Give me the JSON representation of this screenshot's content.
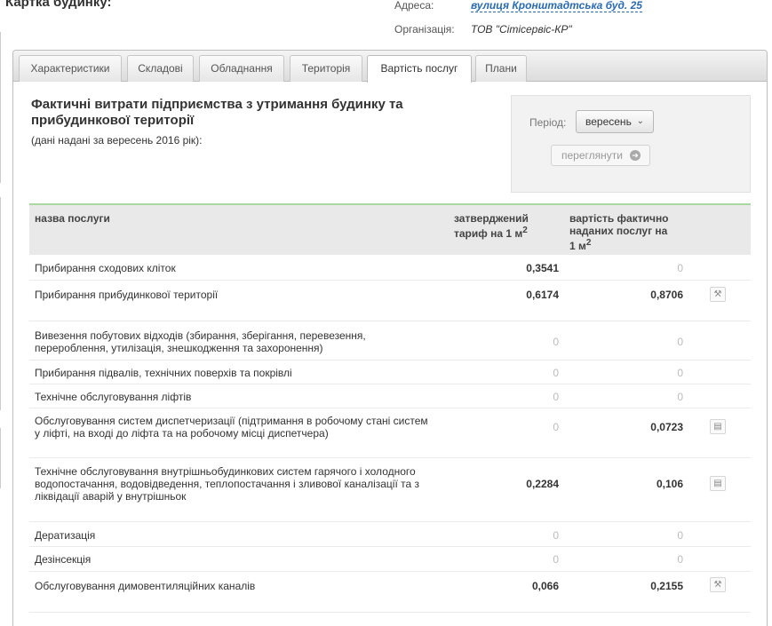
{
  "header": {
    "title": "Картка будинку:",
    "address_label": "Адреса:",
    "address_value": "вулиця Кронштадтська буд. 25",
    "org_label": "Організація:",
    "org_value": "ТОВ \"Сітісервіс-КР\""
  },
  "tabs": [
    {
      "label": "Характеристики",
      "active": false
    },
    {
      "label": "Складові",
      "active": false
    },
    {
      "label": "Обладнання",
      "active": false
    },
    {
      "label": "Територія",
      "active": false
    },
    {
      "label": "Вартість послуг",
      "active": true
    },
    {
      "label": "Плани",
      "active": false
    }
  ],
  "section": {
    "title": "Фактичні витрати підприємства з утримання будинку та прибудинкової території",
    "subtitle": "(дані надані за вересень 2016 рік):"
  },
  "period": {
    "label": "Період:",
    "selected": "вересень",
    "view_button": "переглянути"
  },
  "table": {
    "headers": {
      "name": "назва послуги",
      "tariff": "затверджений тариф на 1 м²",
      "cost": "вартість фактично наданих послуг на 1 м²"
    },
    "rows": [
      {
        "name": "Прибирання сходових кліток",
        "tariff": "0,3541",
        "cost": "0",
        "icon": ""
      },
      {
        "name": "Прибирання прибудинкової території",
        "tariff": "0,6174",
        "cost": "0,8706",
        "icon": "wrench-icon"
      },
      {
        "name": "Вивезення побутових відходів (збирання, зберігання, перевезення, перероблення, утилізація, знешкодження та захоронення)",
        "tariff": "0",
        "cost": "0",
        "icon": ""
      },
      {
        "name": "Прибирання підвалів, технічних поверхів та покрівлі",
        "tariff": "0",
        "cost": "0",
        "icon": ""
      },
      {
        "name": "Технічне обслуговування ліфтів",
        "tariff": "0",
        "cost": "0",
        "icon": ""
      },
      {
        "name": "Обслуговування систем диспетчеризації (підтримання в робочому стані систем у ліфті, на вході до ліфта та на робочому місці диспетчера)",
        "tariff": "0",
        "cost": "0,0723",
        "icon": "document-icon"
      },
      {
        "name": "Технічне обслуговування внутрішньобудинкових систем гарячого і холодного водопостачання, водовідведення, теплопостачання і зливової каналізації та з ліквідації аварій у внутрішньок",
        "tariff": "0,2284",
        "cost": "0,106",
        "icon": "document-icon"
      },
      {
        "name": "Дератизація",
        "tariff": "0",
        "cost": "0",
        "icon": ""
      },
      {
        "name": "Дезінсекція",
        "tariff": "0",
        "cost": "0",
        "icon": ""
      },
      {
        "name": "Обслуговування димовентиляційних каналів",
        "tariff": "0,066",
        "cost": "0,2155",
        "icon": "wrench-icon"
      }
    ]
  },
  "colors": {
    "link": "#2a6ab0",
    "table_header_border": "#a8d8a0"
  }
}
